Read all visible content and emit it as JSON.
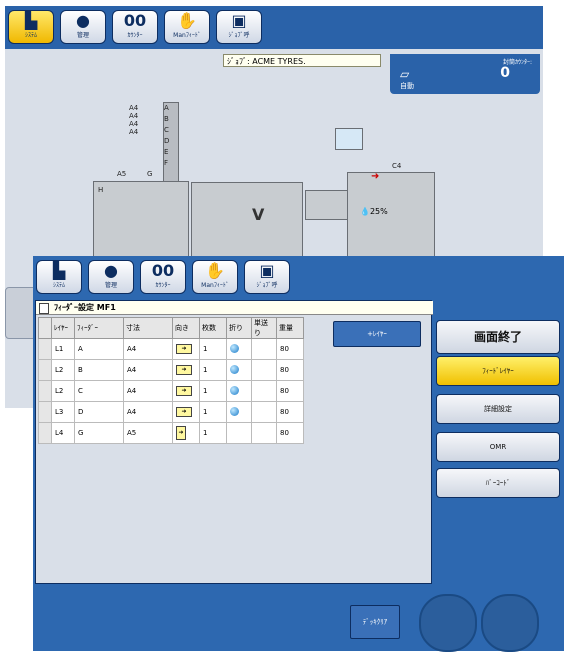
{
  "top_toolbar": {
    "buttons": [
      {
        "label": "ｼｽﾃﾑ",
        "icon": "system-icon",
        "active": true
      },
      {
        "label": "管理",
        "icon": "user-icon",
        "active": false
      },
      {
        "label": "ｶｳﾝﾀｰ",
        "icon": "counter-icon",
        "active": false
      },
      {
        "label": "Manﾌｨｰﾄﾞ",
        "icon": "hand-icon",
        "active": false
      },
      {
        "label": "ｼﾞｮﾌﾞ呼",
        "icon": "job-icon",
        "active": false
      }
    ]
  },
  "job_bar": {
    "text": "ｼﾞｮﾌﾞ: ACME TYRES."
  },
  "counter": {
    "label": "封筒ｶｳﾝﾀｰ:",
    "value": "0",
    "mode": "自動"
  },
  "machine": {
    "trays": [
      "A4",
      "A4",
      "A4",
      "A4"
    ],
    "tray_letters": [
      "A",
      "B",
      "C",
      "D",
      "E",
      "F"
    ],
    "left_tray": "A5",
    "left_letter": "G",
    "base_letter": "H",
    "right_tray": "C4",
    "ink_level": "25%"
  },
  "feeder_panel": {
    "title": "ﾌｨｰﾀﾞｰ設定 MF1",
    "columns": [
      "ﾚｲﾔｰ",
      "ﾌｨｰﾀﾞｰ",
      "寸法",
      "向き",
      "枚数",
      "折り",
      "単送り",
      "重量"
    ],
    "rows": [
      {
        "layer": "L1",
        "feeder": "A",
        "size": "A4",
        "count": "1",
        "fold": true,
        "weight": "80"
      },
      {
        "layer": "L2",
        "feeder": "B",
        "size": "A4",
        "count": "1",
        "fold": true,
        "weight": "80"
      },
      {
        "layer": "L2",
        "feeder": "C",
        "size": "A4",
        "count": "1",
        "fold": true,
        "weight": "80"
      },
      {
        "layer": "L3",
        "feeder": "D",
        "size": "A4",
        "count": "1",
        "fold": true,
        "weight": "80"
      },
      {
        "layer": "L4",
        "feeder": "G",
        "size": "A5",
        "count": "1",
        "fold": false,
        "weight": "80"
      }
    ],
    "add_layer_label": "+ﾚｲﾔｰ"
  },
  "right_buttons": {
    "exit": "画面終了",
    "feed_layer": "ﾌｨｰﾄﾞﾚｲﾔｰ",
    "detail": "詳細設定",
    "omr": "OMR",
    "barcode": "ﾊﾞｰｺｰﾄﾞ"
  },
  "bottom": {
    "desk_clear": "ﾃﾞｯｷｸﾘｱ"
  },
  "colors": {
    "toolbar_blue": "#2a62a9",
    "active_yellow": "#f0c000"
  }
}
